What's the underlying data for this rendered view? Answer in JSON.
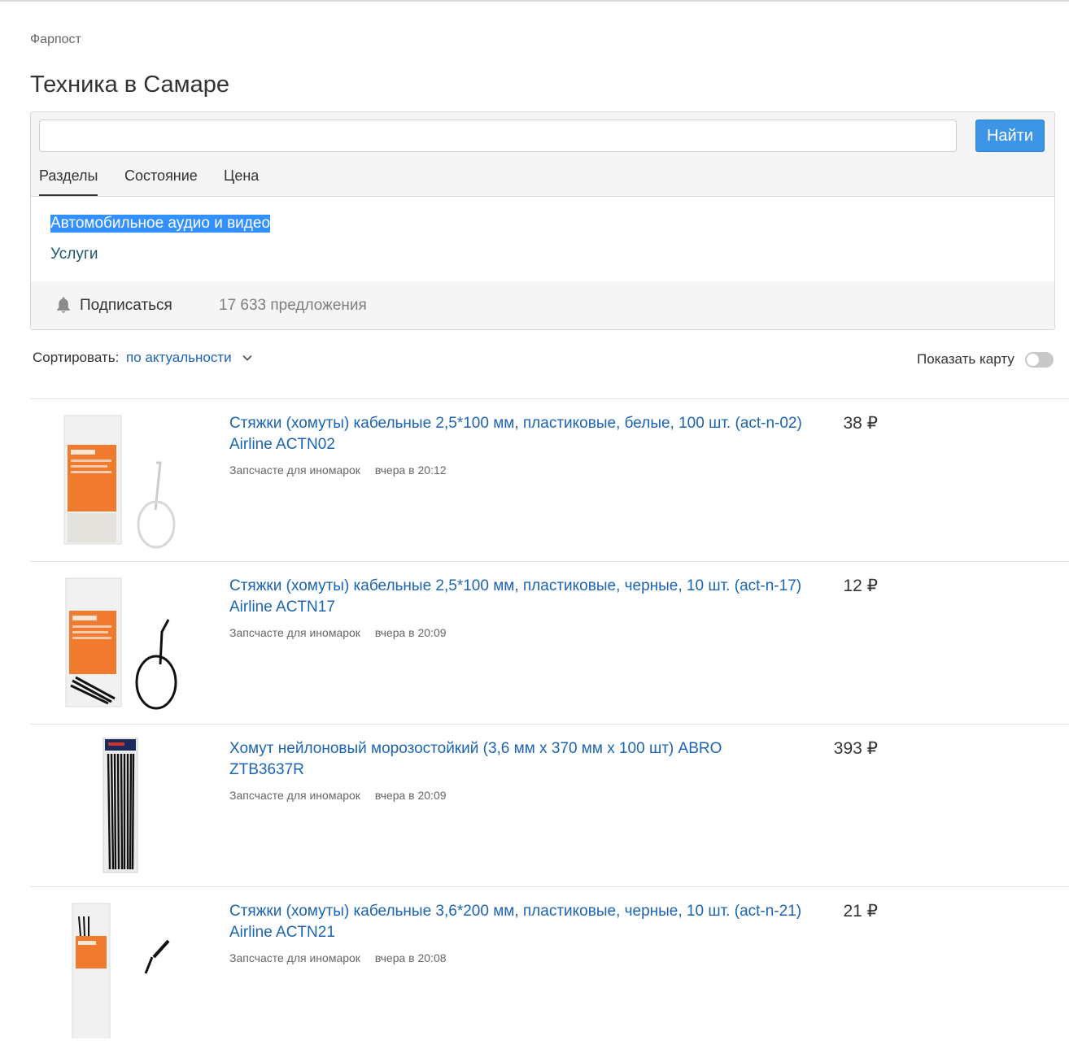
{
  "breadcrumb": "Фарпост",
  "page_title": "Техника в Самаре",
  "search": {
    "value": "",
    "placeholder": "",
    "button_label": "Найти"
  },
  "tabs": [
    {
      "label": "Разделы",
      "active": true
    },
    {
      "label": "Состояние",
      "active": false
    },
    {
      "label": "Цена",
      "active": false
    }
  ],
  "sections": [
    {
      "label": "Автомобильное аудио и видео",
      "selected": true
    },
    {
      "label": "Услуги",
      "selected": false
    }
  ],
  "subscribe": {
    "label": "Подписаться",
    "icon": "bell-icon",
    "offers_count": "17 633 предложения"
  },
  "sort": {
    "label": "Сортировать:",
    "value": "по актуальности"
  },
  "map": {
    "label": "Показать карту",
    "enabled": false
  },
  "items": [
    {
      "title": "Стяжки (хомуты) кабельные 2,5*100 мм, пластиковые, белые, 100 шт. (act-n-02) Airline ACTN02",
      "price": "38 ₽",
      "category": "Запсчасте для иномарок",
      "time": "вчера в 20:12",
      "tie_color": "#ffffff"
    },
    {
      "title": "Стяжки (хомуты) кабельные 2,5*100 мм, пластиковые, черные, 10 шт. (act-n-17) Airline ACTN17",
      "price": "12 ₽",
      "category": "Запсчасте для иномарок",
      "time": "вчера в 20:09",
      "tie_color": "#111111"
    },
    {
      "title": "Хомут нейлоновый морозостойкий (3,6 мм х 370 мм х 100 шт) ABRO ZTB3637R",
      "price": "393 ₽",
      "category": "Запсчасте для иномарок",
      "time": "вчера в 20:09",
      "tie_color": "#111111"
    },
    {
      "title": "Стяжки (хомуты) кабельные 3,6*200 мм, пластиковые, черные, 10 шт. (act-n-21) Airline ACTN21",
      "price": "21 ₽",
      "category": "Запсчасте для иномарок",
      "time": "вчера в 20:08",
      "tie_color": "#111111"
    }
  ]
}
